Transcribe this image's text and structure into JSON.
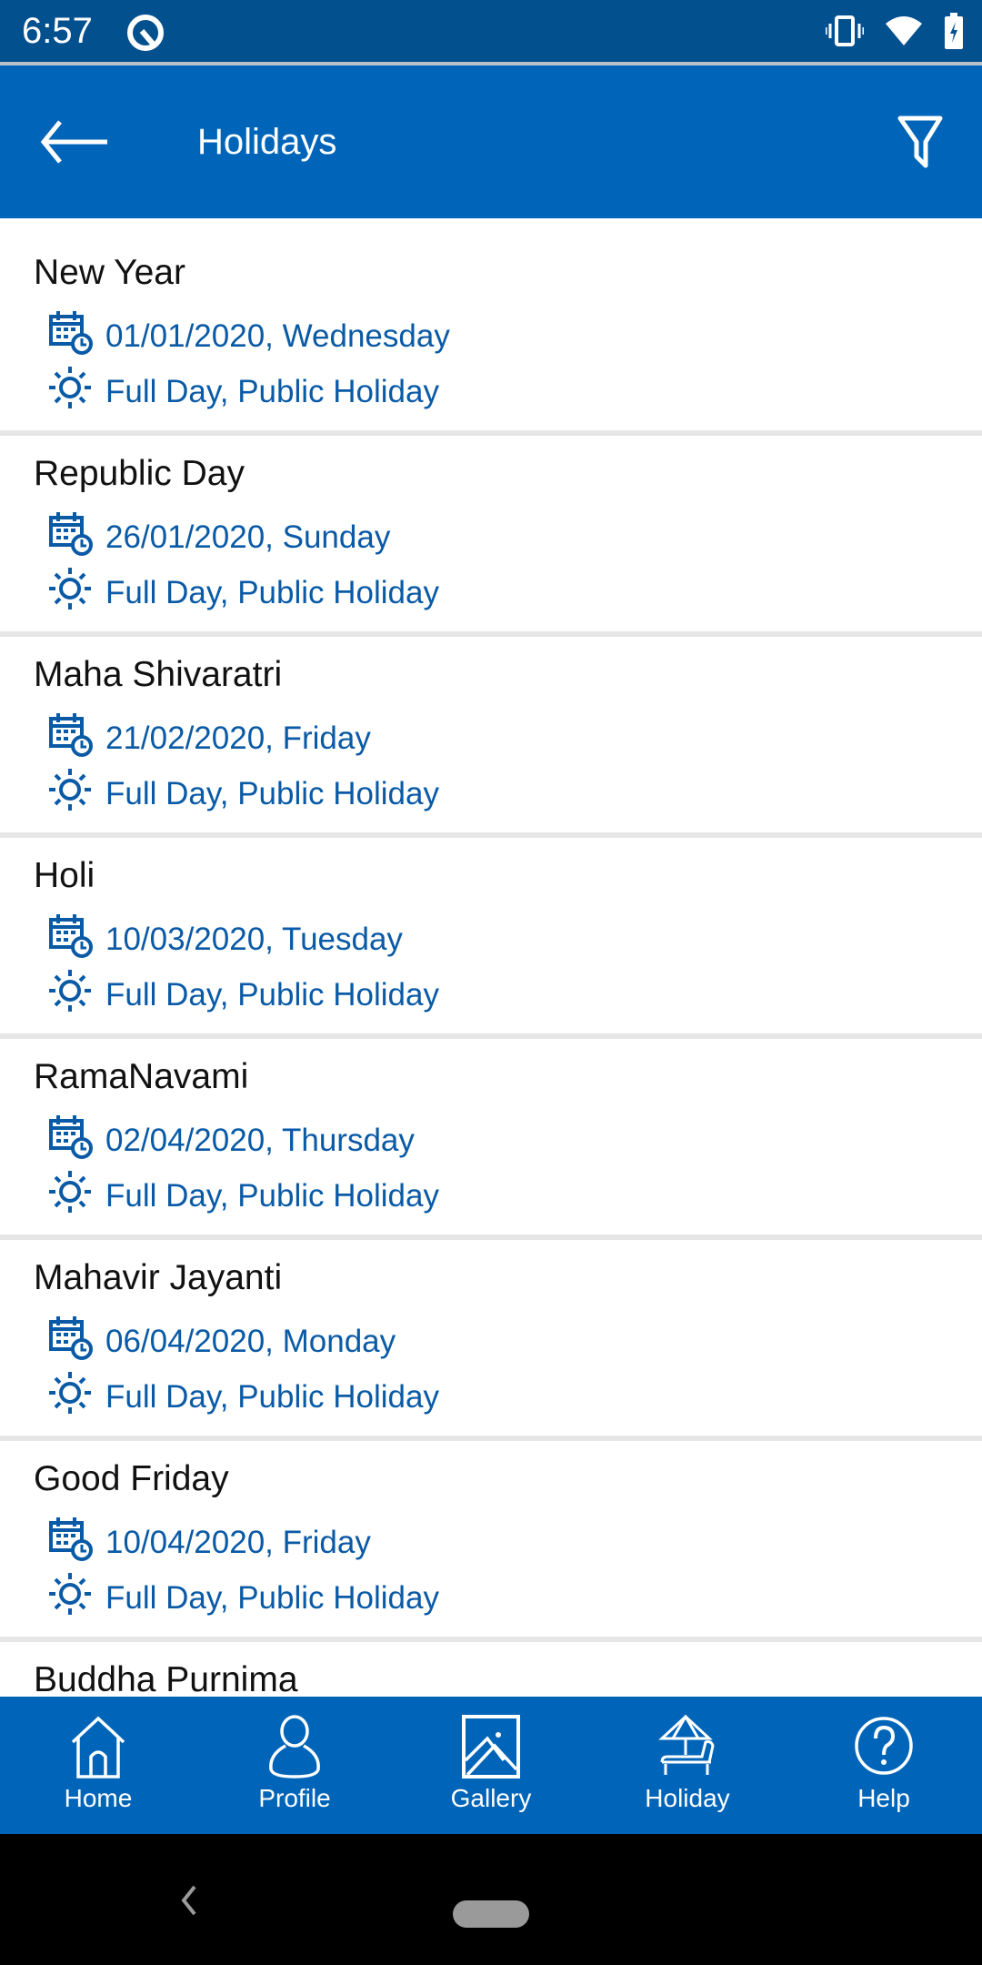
{
  "status_bar": {
    "time": "6:57",
    "icons": [
      "at-notification-icon",
      "vibrate-icon",
      "wifi-icon",
      "battery-charging-icon"
    ]
  },
  "toolbar": {
    "title": "Holidays",
    "back_icon": "arrow-left-icon",
    "filter_icon": "filter-icon"
  },
  "holidays": [
    {
      "name": "New Year",
      "date": "01/01/2020, Wednesday",
      "type": "Full Day, Public Holiday"
    },
    {
      "name": "Republic Day",
      "date": "26/01/2020, Sunday",
      "type": "Full Day, Public Holiday"
    },
    {
      "name": "Maha Shivaratri",
      "date": "21/02/2020, Friday",
      "type": "Full Day, Public Holiday"
    },
    {
      "name": "Holi",
      "date": "10/03/2020, Tuesday",
      "type": "Full Day, Public Holiday"
    },
    {
      "name": "RamaNavami",
      "date": "02/04/2020, Thursday",
      "type": "Full Day, Public Holiday"
    },
    {
      "name": "Mahavir Jayanti",
      "date": "06/04/2020, Monday",
      "type": "Full Day, Public Holiday"
    },
    {
      "name": "Good Friday",
      "date": "10/04/2020, Friday",
      "type": "Full Day, Public Holiday"
    },
    {
      "name": "Buddha Purnima"
    }
  ],
  "bottom_nav": [
    {
      "label": "Home",
      "icon": "home-icon"
    },
    {
      "label": "Profile",
      "icon": "profile-icon"
    },
    {
      "label": "Gallery",
      "icon": "gallery-icon"
    },
    {
      "label": "Holiday",
      "icon": "beach-umbrella-icon"
    },
    {
      "label": "Help",
      "icon": "help-icon"
    }
  ],
  "colors": {
    "primary": "#0065b8",
    "status_bar": "#03508f",
    "detail_text": "#0a5aa6"
  }
}
